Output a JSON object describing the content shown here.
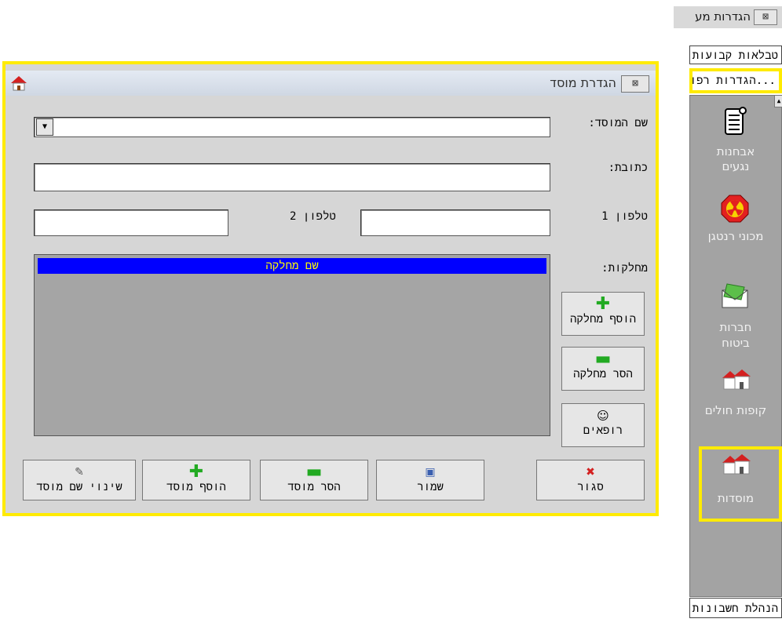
{
  "side_panel": {
    "title": "הגדרות מע",
    "close_glyph": "⊠",
    "tab1": "טבלאות קבועות",
    "tab2": "...הגדרות רפואי",
    "scroll_glyph": "▲",
    "items": [
      {
        "label": "אבחנות\nנגעים",
        "icon": "scroll-icon"
      },
      {
        "label": "מכוני רנטגן",
        "icon": "radiation-icon"
      },
      {
        "label": "חברות\nביטוח",
        "icon": "money-envelope-icon"
      },
      {
        "label": "קופות חולים",
        "icon": "houses-icon"
      },
      {
        "label": "מוסדות",
        "icon": "houses-icon"
      }
    ],
    "bottom_tab": "הנהלת חשבונות"
  },
  "dialog": {
    "title": "הגדרת מוסד",
    "close_glyph": "⊠",
    "labels": {
      "institution_name": "שם המוסד:",
      "address": "כתובת:",
      "phone1": "טלפון 1",
      "phone2": "טלפון 2",
      "departments": "מחלקות:"
    },
    "fields": {
      "institution_name": "",
      "address": "",
      "phone1": "",
      "phone2": ""
    },
    "dropdown_glyph": "▼",
    "departments_header": "שם מחלקה",
    "side_buttons": {
      "add_department": "הוסף מחלקה",
      "remove_department": "הסר מחלקה",
      "doctors": "רופאים"
    },
    "bottom_buttons": {
      "close": "סגור",
      "save": "שמור",
      "remove_institution": "הסר מוסד",
      "add_institution": "הוסף מוסד",
      "rename_institution": "שינוי שם מוסד"
    }
  }
}
